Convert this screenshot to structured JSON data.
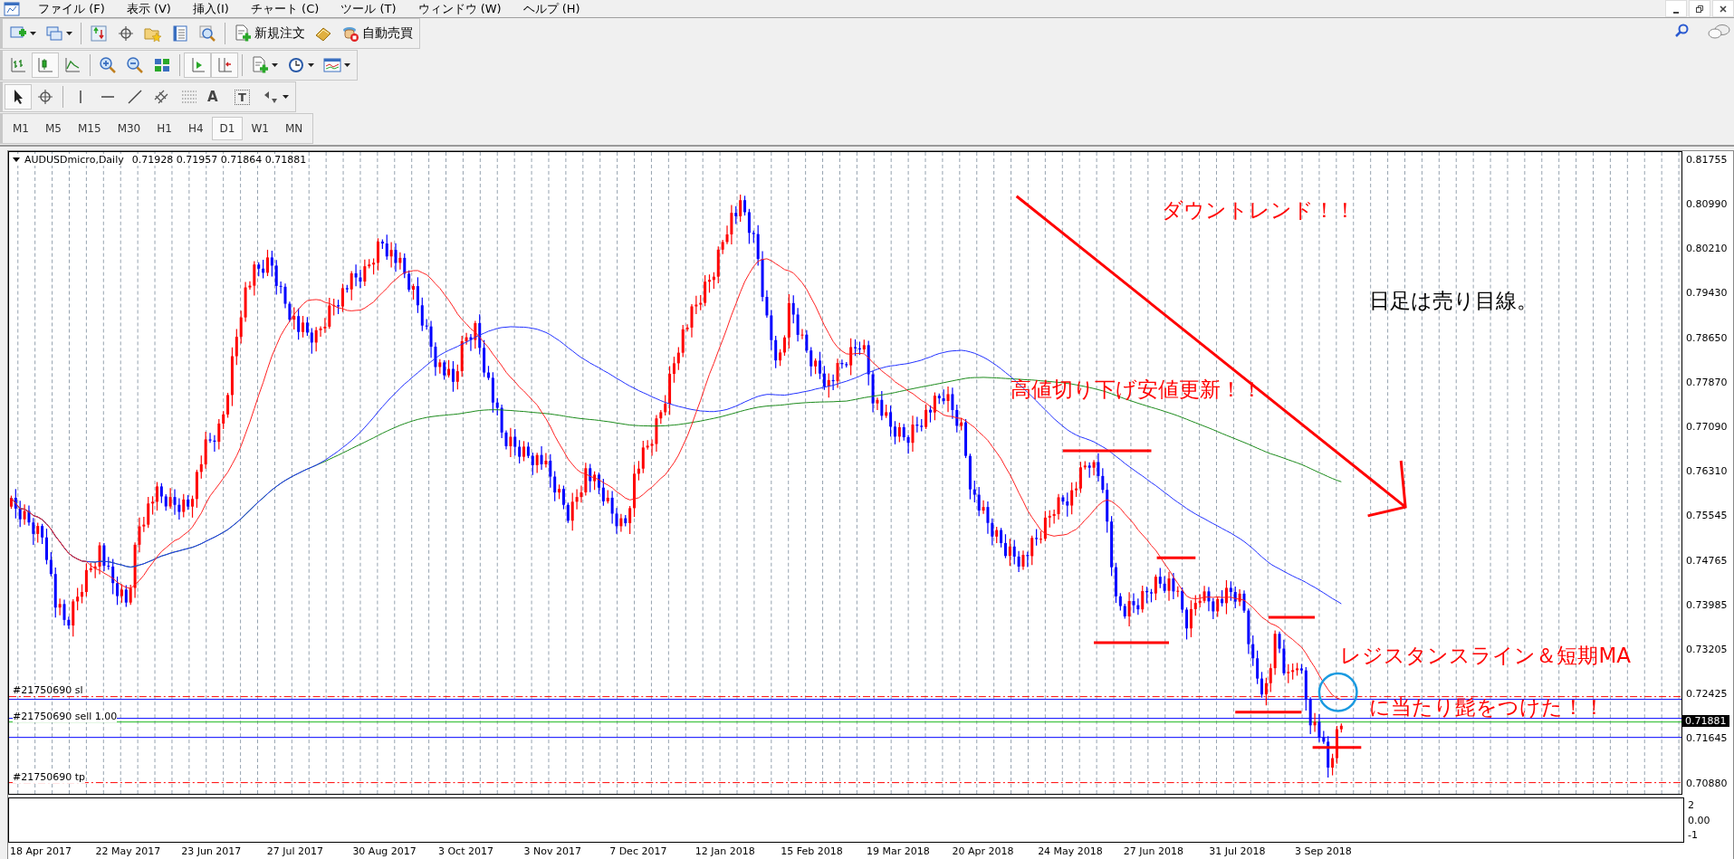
{
  "menu": [
    "ファイル (F)",
    "表示 (V)",
    "挿入(I)",
    "チャート (C)",
    "ツール (T)",
    "ウィンドウ (W)",
    "ヘルプ (H)"
  ],
  "toolbars": [
    [
      {
        "kind": "new-chart",
        "pressed": false,
        "dropdown": true
      },
      {
        "kind": "profiles",
        "pressed": false,
        "dropdown": true
      },
      {
        "kind": "separator"
      },
      {
        "kind": "market-watch",
        "pressed": false,
        "dropdown": false
      },
      {
        "kind": "navigator",
        "pressed": false,
        "dropdown": false
      },
      {
        "kind": "favorites",
        "pressed": false,
        "dropdown": false
      },
      {
        "kind": "terminal",
        "pressed": false,
        "dropdown": false
      },
      {
        "kind": "tester",
        "pressed": false,
        "dropdown": false
      },
      {
        "kind": "separator"
      },
      {
        "kind": "new-order",
        "label": "新規注文",
        "pressed": false,
        "dropdown": false
      },
      {
        "kind": "editor",
        "pressed": false,
        "dropdown": false
      },
      {
        "kind": "autotrading",
        "label": "自動売買",
        "pressed": false,
        "dropdown": false
      }
    ],
    [
      {
        "kind": "bar-chart",
        "pressed": false,
        "dropdown": false
      },
      {
        "kind": "candles",
        "pressed": true,
        "dropdown": false
      },
      {
        "kind": "line-chart",
        "pressed": false,
        "dropdown": false
      },
      {
        "kind": "separator"
      },
      {
        "kind": "zoom-in",
        "pressed": false,
        "dropdown": false
      },
      {
        "kind": "zoom-out",
        "pressed": false,
        "dropdown": false
      },
      {
        "kind": "tile",
        "pressed": false,
        "dropdown": false
      },
      {
        "kind": "separator"
      },
      {
        "kind": "autoscroll",
        "pressed": true,
        "dropdown": false
      },
      {
        "kind": "shift",
        "pressed": true,
        "dropdown": false
      },
      {
        "kind": "separator"
      },
      {
        "kind": "indicators",
        "pressed": false,
        "dropdown": true
      },
      {
        "kind": "periods",
        "pressed": false,
        "dropdown": true
      },
      {
        "kind": "templates",
        "pressed": false,
        "dropdown": true
      }
    ],
    [
      {
        "kind": "cursor",
        "pressed": true,
        "dropdown": false
      },
      {
        "kind": "crosshair",
        "pressed": false,
        "dropdown": false
      },
      {
        "kind": "separator"
      },
      {
        "kind": "vline",
        "pressed": false,
        "dropdown": false
      },
      {
        "kind": "hline",
        "pressed": false,
        "dropdown": false
      },
      {
        "kind": "trendline",
        "pressed": false,
        "dropdown": false
      },
      {
        "kind": "channel",
        "pressed": false,
        "dropdown": false
      },
      {
        "kind": "fibo",
        "pressed": false,
        "dropdown": false
      },
      {
        "kind": "text-tool",
        "label": "A",
        "pressed": false,
        "dropdown": false
      },
      {
        "kind": "text-label",
        "label": "T",
        "pressed": false,
        "dropdown": false
      },
      {
        "kind": "shapes",
        "pressed": false,
        "dropdown": true
      }
    ]
  ],
  "timeframes": [
    {
      "label": "M1",
      "selected": false
    },
    {
      "label": "M5",
      "selected": false
    },
    {
      "label": "M15",
      "selected": false
    },
    {
      "label": "M30",
      "selected": false
    },
    {
      "label": "H1",
      "selected": false
    },
    {
      "label": "H4",
      "selected": false
    },
    {
      "label": "D1",
      "selected": true
    },
    {
      "label": "W1",
      "selected": false
    },
    {
      "label": "MN",
      "selected": false
    }
  ],
  "chart": {
    "symbol": "AUDUSDmicro,Daily",
    "ohlc": "0.71928 0.71957 0.71864 0.71881",
    "price_axis": [
      "0.81755",
      "0.80990",
      "0.80210",
      "0.79430",
      "0.78650",
      "0.77870",
      "0.77090",
      "0.76310",
      "0.75545",
      "0.74765",
      "0.73985",
      "0.73205",
      "0.72425",
      "0.71645",
      "0.70880"
    ],
    "current_price": "0.71881",
    "order_lines": [
      {
        "label": "#21750690 sl",
        "kind": "sl"
      },
      {
        "label": "#21750690 sell 1.00",
        "kind": "entry"
      },
      {
        "label": "#21750690 tp",
        "kind": "tp"
      }
    ],
    "annotations": [
      {
        "text": "ダウントレンド！！",
        "color": "#ff0000"
      },
      {
        "text": "日足は売り目線。",
        "color": "#000000"
      },
      {
        "text": "高値切り下げ安値更新！！",
        "color": "#ff0000"
      },
      {
        "text": "レジスタンスライン＆短期MA",
        "color": "#ff0000"
      },
      {
        "text": "に当たり髭をつけた！！",
        "color": "#ff0000"
      }
    ],
    "sub_axis": [
      "2",
      "0.00",
      "-1"
    ],
    "dates": [
      "18 Apr 2017",
      "22 May 2017",
      "23 Jun 2017",
      "27 Jul 2017",
      "30 Aug 2017",
      "3 Oct 2017",
      "3 Nov 2017",
      "7 Dec 2017",
      "12 Jan 2018",
      "15 Feb 2018",
      "19 Mar 2018",
      "20 Apr 2018",
      "24 May 2018",
      "27 Jun 2018",
      "31 Jul 2018",
      "3 Sep 2018"
    ]
  }
}
